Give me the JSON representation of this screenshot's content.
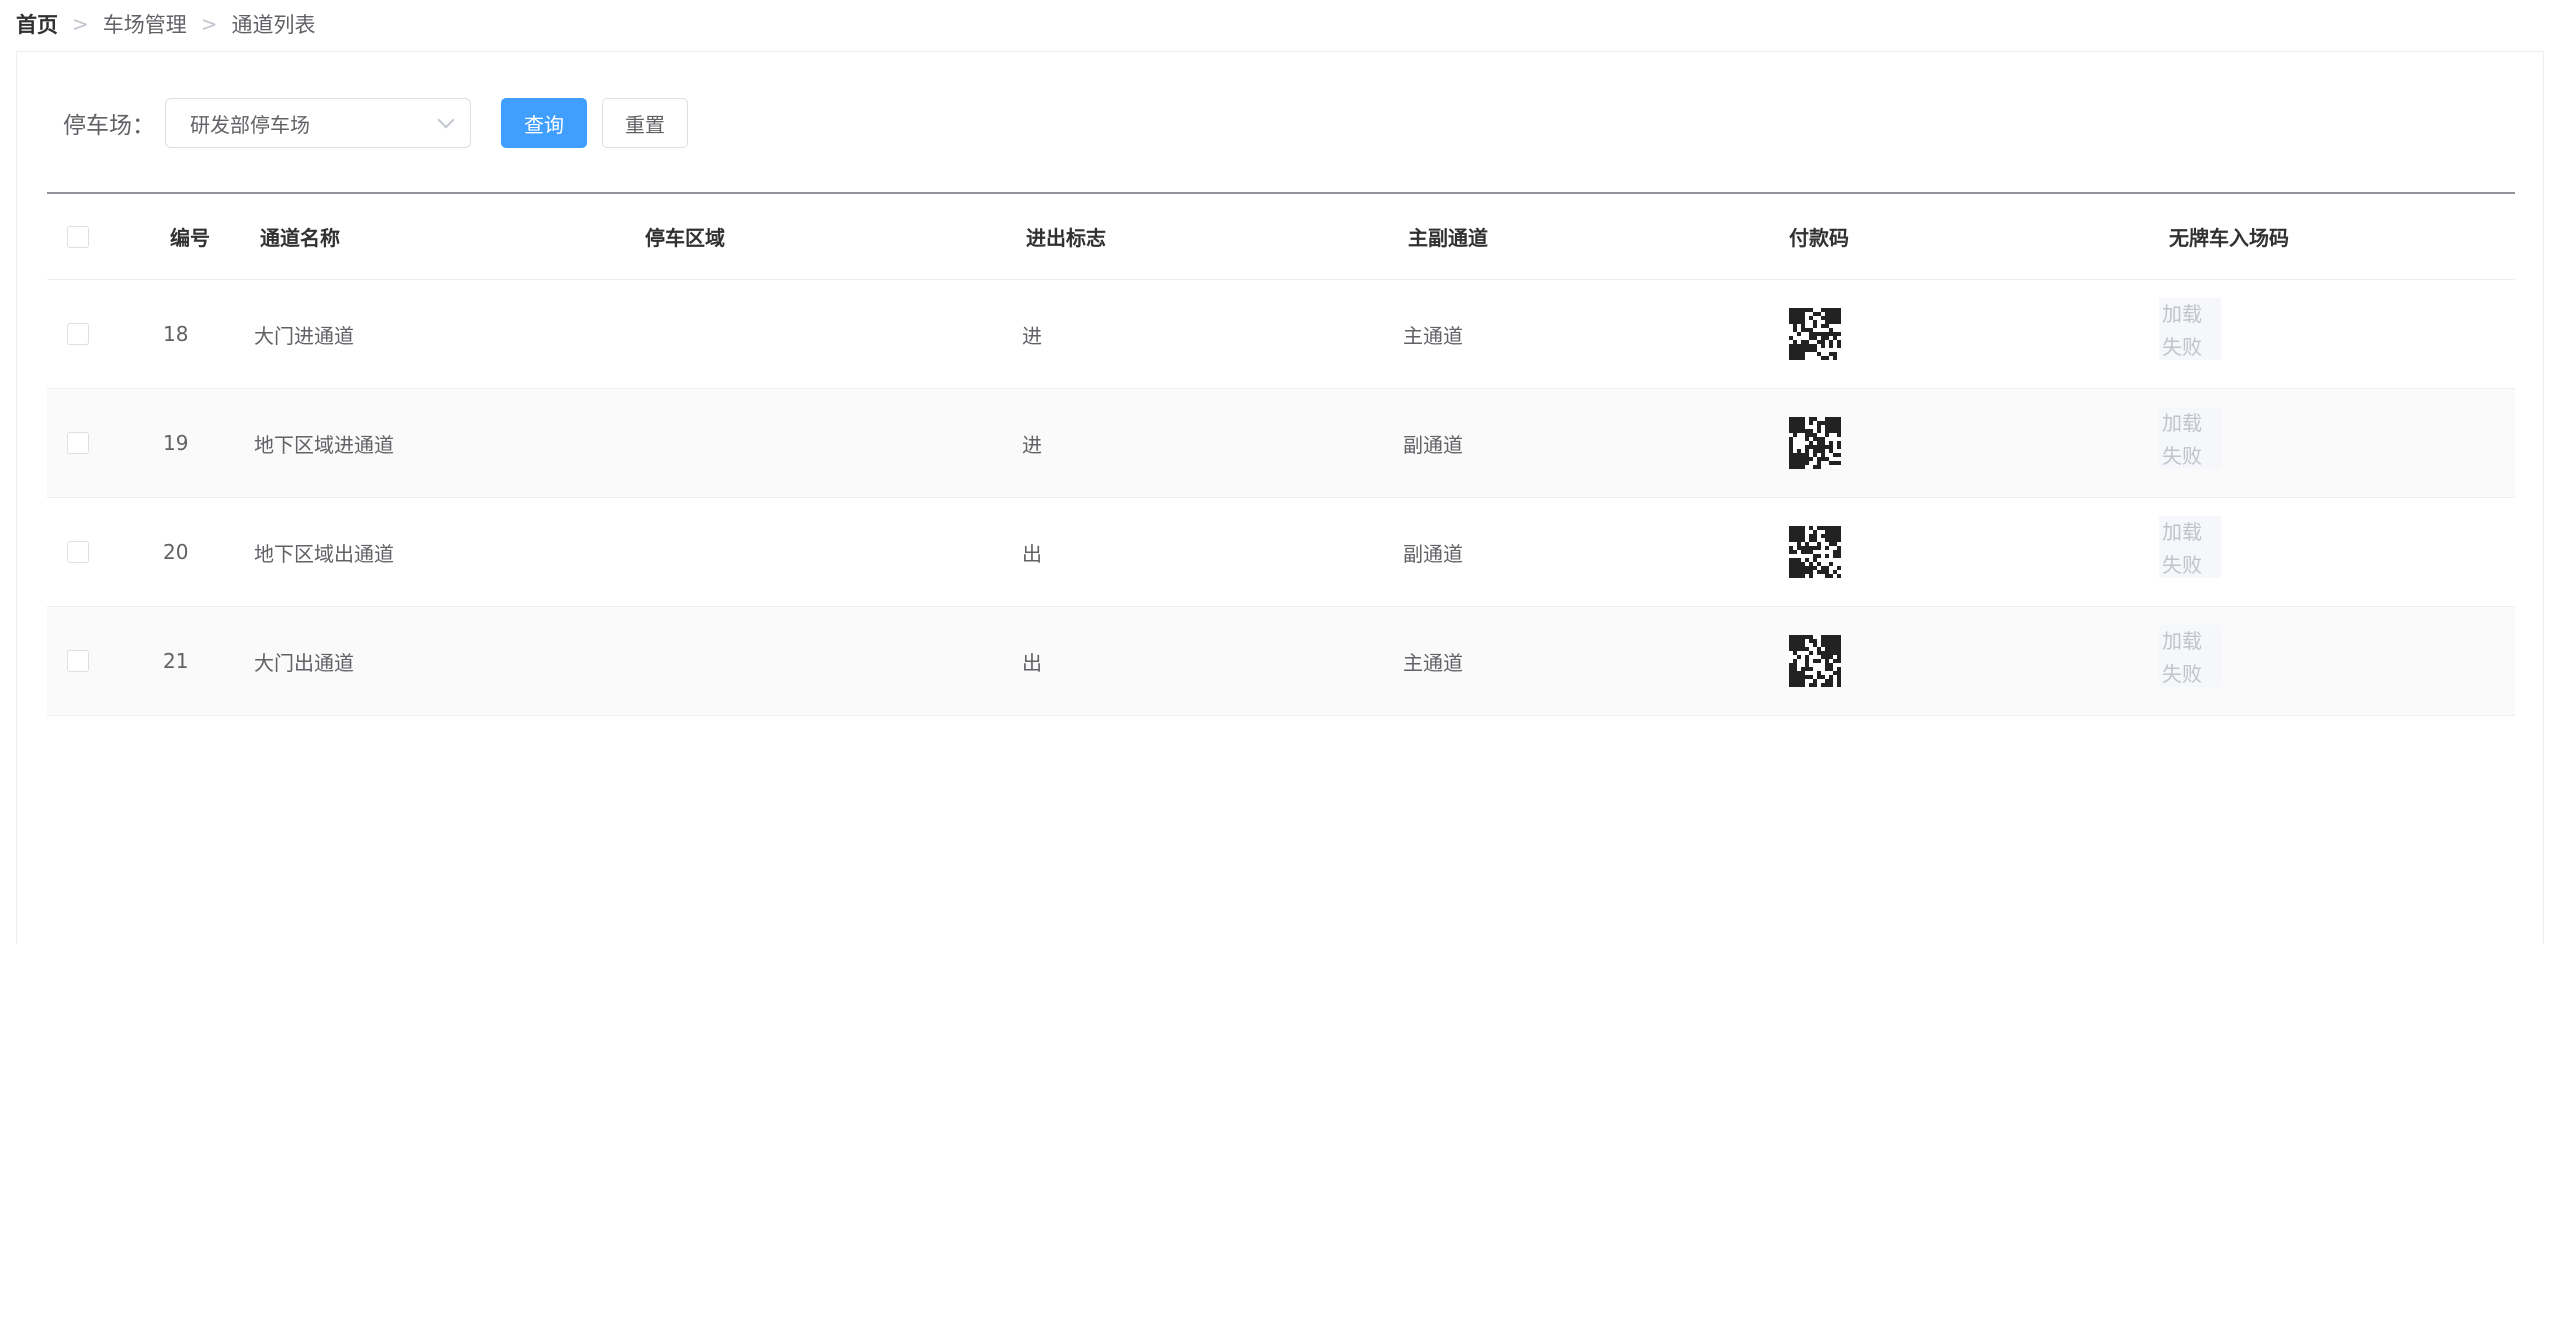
{
  "breadcrumb": {
    "items": [
      "首页",
      "车场管理",
      "通道列表"
    ]
  },
  "filter": {
    "parking_label": "停车场：",
    "parking_value": "研发部停车场",
    "query_label": "查询",
    "reset_label": "重置"
  },
  "table": {
    "headers": {
      "id": "编号",
      "name": "通道名称",
      "area": "停车区域",
      "flag": "进出标志",
      "main": "主副通道",
      "pay": "付款码",
      "noplate": "无牌车入场码"
    },
    "rows": [
      {
        "id": "18",
        "name": "大门进通道",
        "area": "",
        "flag": "进",
        "main": "主通道",
        "noplate_line1": "加载",
        "noplate_line2": "失败"
      },
      {
        "id": "19",
        "name": "地下区域进通道",
        "area": "",
        "flag": "进",
        "main": "副通道",
        "noplate_line1": "加载",
        "noplate_line2": "失败"
      },
      {
        "id": "20",
        "name": "地下区域出通道",
        "area": "",
        "flag": "出",
        "main": "副通道",
        "noplate_line1": "加载",
        "noplate_line2": "失败"
      },
      {
        "id": "21",
        "name": "大门出通道",
        "area": "",
        "flag": "出",
        "main": "主通道",
        "noplate_line1": "加载",
        "noplate_line2": "失败"
      }
    ]
  },
  "icons": {
    "select_arrow": "chevron-down-icon",
    "pay_code": "qr-code-icon"
  },
  "colors": {
    "primary": "#409eff",
    "text": "#606266",
    "header_text": "#303133",
    "border": "#ebeef5",
    "stripe": "#fafafa",
    "failed_text": "#c0c4cc"
  }
}
